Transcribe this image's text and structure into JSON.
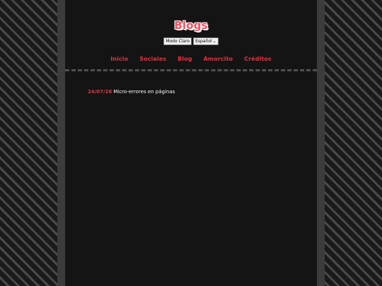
{
  "header": {
    "title": "Blogs"
  },
  "controls": {
    "theme_button": "Modo Claro",
    "language_selected": "Español"
  },
  "nav": {
    "items": [
      {
        "label": "Inicio"
      },
      {
        "label": "Sociales"
      },
      {
        "label": "Blog"
      },
      {
        "label": "Amorcito"
      },
      {
        "label": "Créditos"
      }
    ]
  },
  "posts": [
    {
      "date": "24/07/26",
      "title": "Micro-errores en páginas"
    }
  ]
}
